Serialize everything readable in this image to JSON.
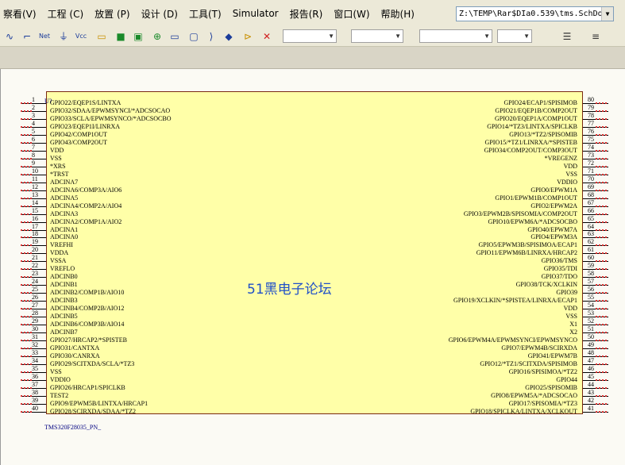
{
  "menu": [
    "察看(V)",
    "工程 (C)",
    "放置 (P)",
    "设计 (D)",
    "工具(T)",
    "Simulator",
    "报告(R)",
    "窗口(W)",
    "帮助(H)"
  ],
  "path_box": "Z:\\TEMP\\Rar$DIa0.539\\tms.SchDoc",
  "toolbar_icons": [
    "wire-icon",
    "bus-icon",
    "net-label-icon",
    "gnd-icon",
    "vcc-icon",
    "part-icon",
    "sheet-symbol-icon",
    "sheet-entry-icon",
    "harness-icon",
    "port-icon",
    "off-sheet-icon",
    "directive-icon",
    "no-erc-icon",
    "compile-mask-icon",
    "delete-icon"
  ],
  "component": {
    "designator": "U?",
    "comment": "TMS320F28035_PN_",
    "watermark": "51黑电子论坛"
  },
  "pins_left": [
    {
      "num": "1",
      "name": "GPIO22/EQEP1S/LINTXA"
    },
    {
      "num": "2",
      "name": "GPIO32/SDAA/EPWMSYNCI/*ADCSOCAO"
    },
    {
      "num": "3",
      "name": "GPIO33/SCLA/EPWMSYNCO/*ADCSOCBO"
    },
    {
      "num": "4",
      "name": "GPIO23/EQEP1I/LINRXA"
    },
    {
      "num": "5",
      "name": "GPIO42/COMP1OUT"
    },
    {
      "num": "6",
      "name": "GPIO43/COMP2OUT"
    },
    {
      "num": "7",
      "name": "VDD"
    },
    {
      "num": "8",
      "name": "VSS"
    },
    {
      "num": "9",
      "name": "*XRS"
    },
    {
      "num": "10",
      "name": "*TRST"
    },
    {
      "num": "11",
      "name": "ADCINA7"
    },
    {
      "num": "12",
      "name": "ADCINA6/COMP3A/AIO6"
    },
    {
      "num": "13",
      "name": "ADCINA5"
    },
    {
      "num": "14",
      "name": "ADCINA4/COMP2A/AIO4"
    },
    {
      "num": "15",
      "name": "ADCINA3"
    },
    {
      "num": "16",
      "name": "ADCINA2/COMP1A/AIO2"
    },
    {
      "num": "17",
      "name": "ADCINA1"
    },
    {
      "num": "18",
      "name": "ADCINA0"
    },
    {
      "num": "19",
      "name": "VREFHI"
    },
    {
      "num": "20",
      "name": "VDDA"
    },
    {
      "num": "21",
      "name": "VSSA"
    },
    {
      "num": "22",
      "name": "VREFLO"
    },
    {
      "num": "23",
      "name": "ADCINB0"
    },
    {
      "num": "24",
      "name": "ADCINB1"
    },
    {
      "num": "25",
      "name": "ADCINB2/COMP1B/AIO10"
    },
    {
      "num": "26",
      "name": "ADCINB3"
    },
    {
      "num": "27",
      "name": "ADCINB4/COMP2B/AIO12"
    },
    {
      "num": "28",
      "name": "ADCINB5"
    },
    {
      "num": "29",
      "name": "ADCINB6/COMP3B/AIO14"
    },
    {
      "num": "30",
      "name": "ADCINB7"
    },
    {
      "num": "31",
      "name": "GPIO27/HRCAP2/*SPISTEB"
    },
    {
      "num": "32",
      "name": "GPIO31/CANTXA"
    },
    {
      "num": "33",
      "name": "GPIO30/CANRXA"
    },
    {
      "num": "34",
      "name": "GPIO29/SCITXDA/SCLA/*TZ3"
    },
    {
      "num": "35",
      "name": "VSS"
    },
    {
      "num": "36",
      "name": "VDDIO"
    },
    {
      "num": "37",
      "name": "GPIO26/HRCAP1/SPICLKB"
    },
    {
      "num": "38",
      "name": "TEST2"
    },
    {
      "num": "39",
      "name": "GPIO9/EPWM5B/LINTXA/HRCAP1"
    },
    {
      "num": "40",
      "name": "GPIO28/SCIRXDA/SDAA/*TZ2"
    }
  ],
  "pins_right": [
    {
      "num": "80",
      "name": "GPIO24/ECAP1/SPISIMOB"
    },
    {
      "num": "79",
      "name": "GPIO21/EQEP1B/COMP2OUT"
    },
    {
      "num": "78",
      "name": "GPIO20/EQEP1A/COMP1OUT"
    },
    {
      "num": "77",
      "name": "GPIO14/*TZ3/LINTXA/SPICLKB"
    },
    {
      "num": "76",
      "name": "GPIO13/*TZ2/SPISOMIB"
    },
    {
      "num": "75",
      "name": "GPIO15/*TZ1/LINRXA/*SPISTEB"
    },
    {
      "num": "74",
      "name": "GPIO34/COMP2OUT/COMP3OUT"
    },
    {
      "num": "73",
      "name": "*VREGENZ"
    },
    {
      "num": "72",
      "name": "VDD"
    },
    {
      "num": "71",
      "name": "VSS"
    },
    {
      "num": "70",
      "name": "VDDIO"
    },
    {
      "num": "69",
      "name": "GPIO0/EPWM1A"
    },
    {
      "num": "68",
      "name": "GPIO1/EPWM1B/COMP1OUT"
    },
    {
      "num": "67",
      "name": "GPIO2/EPWM2A"
    },
    {
      "num": "66",
      "name": "GPIO3/EPWM2B/SPISOMIA/COMP2OUT"
    },
    {
      "num": "65",
      "name": "GPIO10/EPWM6A/*ADCSOCBO"
    },
    {
      "num": "64",
      "name": "GPIO40/EPWM7A"
    },
    {
      "num": "63",
      "name": "GPIO4/EPWM3A"
    },
    {
      "num": "62",
      "name": "GPIO5/EPWM3B/SPISIMOA/ECAP1"
    },
    {
      "num": "61",
      "name": "GPIO11/EPWM6B/LINRXA/HRCAP2"
    },
    {
      "num": "60",
      "name": "GPIO36/TMS"
    },
    {
      "num": "59",
      "name": "GPIO35/TDI"
    },
    {
      "num": "58",
      "name": "GPIO37/TDO"
    },
    {
      "num": "57",
      "name": "GPIO38/TCK/XCLKIN"
    },
    {
      "num": "56",
      "name": "GPIO39"
    },
    {
      "num": "55",
      "name": "GPIO19/XCLKIN/*SPISTEA/LINRXA/ECAP1"
    },
    {
      "num": "54",
      "name": "VDD"
    },
    {
      "num": "53",
      "name": "VSS"
    },
    {
      "num": "52",
      "name": "X1"
    },
    {
      "num": "51",
      "name": "X2"
    },
    {
      "num": "50",
      "name": "GPIO6/EPWM4A/EPWMSYNCI/EPWMSYNCO"
    },
    {
      "num": "49",
      "name": "GPIO7/EPWM4B/SCIRXDA"
    },
    {
      "num": "48",
      "name": "GPIO41/EPWM7B"
    },
    {
      "num": "47",
      "name": "GPIO12/*TZ1/SCITXDA/SPISIMOB"
    },
    {
      "num": "46",
      "name": "GPIO16/SPISIMOA/*TZ2"
    },
    {
      "num": "45",
      "name": "GPIO44"
    },
    {
      "num": "44",
      "name": "GPIO25/SPISOMIB"
    },
    {
      "num": "43",
      "name": "GPIO8/EPWM5A/*ADCSOCAO"
    },
    {
      "num": "42",
      "name": "GPIO17/SPISOMIA/*TZ3"
    },
    {
      "num": "41",
      "name": "GPIO18/SPICLKA/LINTXA/XCLKOUT"
    }
  ]
}
